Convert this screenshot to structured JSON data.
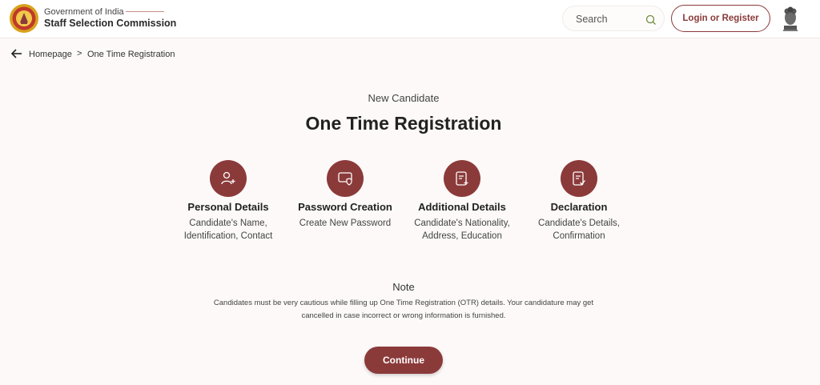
{
  "header": {
    "org_sub": "Government of India",
    "org_name": "Staff Selection Commission",
    "search_placeholder": "Search",
    "login_label": "Login or Register"
  },
  "breadcrumb": {
    "home": "Homepage",
    "separator": ">",
    "current": "One Time Registration"
  },
  "main": {
    "subtitle": "New Candidate",
    "title": "One Time Registration"
  },
  "steps": [
    {
      "title": "Personal Details",
      "desc": "Candidate's Name, Identification, Contact",
      "icon": "user-add-icon"
    },
    {
      "title": "Password Creation",
      "desc": "Create New Password",
      "icon": "password-shield-icon"
    },
    {
      "title": "Additional Details",
      "desc": "Candidate's Nationality, Address, Education",
      "icon": "document-add-icon"
    },
    {
      "title": "Declaration",
      "desc": "Candidate's Details, Confirmation",
      "icon": "document-check-icon"
    }
  ],
  "note": {
    "title": "Note",
    "text": "Candidates must be very cautious while filling up One Time Registration (OTR) details. Your candidature may get cancelled in case incorrect or wrong information is furnished."
  },
  "continue_label": "Continue",
  "colors": {
    "accent": "#8b3a3a",
    "background": "#fcf9f8"
  }
}
